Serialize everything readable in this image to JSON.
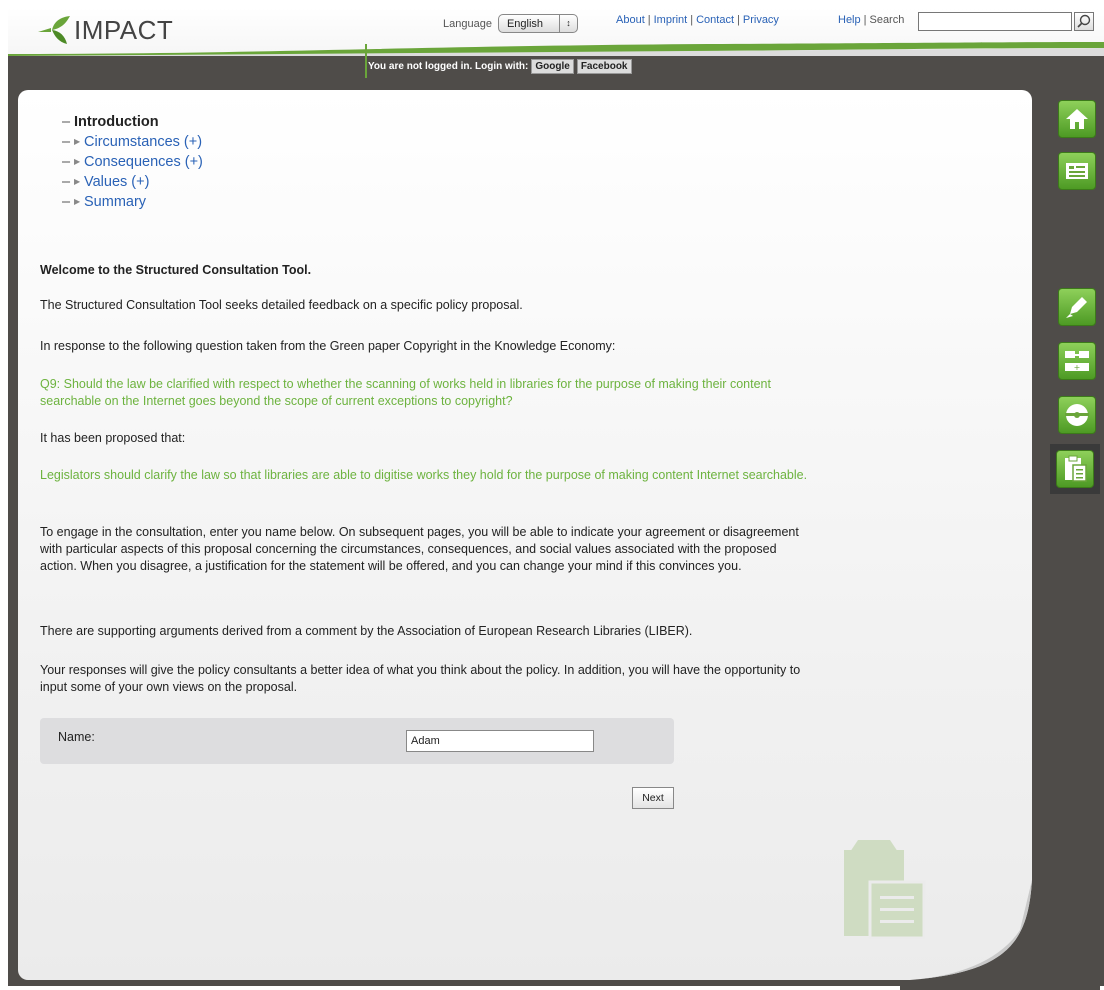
{
  "header": {
    "logo_text": "IMPACT",
    "language_label": "Language",
    "language_value": "English",
    "links": [
      "About",
      "Imprint",
      "Contact",
      "Privacy"
    ],
    "help": "Help",
    "search": "Search",
    "login_text": "You are not logged in. Login with:",
    "login_google": "Google",
    "login_facebook": "Facebook"
  },
  "toc": {
    "current": "Introduction",
    "items": [
      "Circumstances (+)",
      "Consequences (+)",
      "Values (+)",
      "Summary"
    ]
  },
  "content": {
    "welcome": "Welcome to the Structured Consultation Tool.",
    "p1": "The Structured Consultation Tool seeks detailed feedback on a specific policy proposal.",
    "p2": "In response to the following question taken from the Green paper Copyright in the Knowledge Economy:",
    "question": "Q9: Should the law be clarified with respect to whether the scanning of works held in libraries for the purpose of making their content searchable on the Internet goes beyond the scope of current exceptions to copyright?",
    "p3": "It has been proposed that:",
    "proposal": "Legislators should clarify the law so that libraries are able to digitise works they hold for the purpose of making content Internet searchable.",
    "p4": "To engage in the consultation, enter you name below. On subsequent pages, you will be able to indicate your agreement or disagreement with particular aspects of this proposal concerning the circumstances, consequences, and social values associated with the proposed action. When you disagree, a justification for the statement will be offered, and you can change your mind if this convinces you.",
    "p5": "There are supporting arguments derived from a comment by the Association of European Research Libraries (LIBER).",
    "p6": "Your responses will give the policy consultants a better idea of what you think about the policy. In addition, you will have the opportunity to input some of your own views on the proposal."
  },
  "form": {
    "name_label": "Name:",
    "name_value": "Adam",
    "next_label": "Next"
  },
  "sidenav": {
    "icons": [
      "home-icon",
      "document-icon",
      "pencil-icon",
      "diagram-icon",
      "disc-icon",
      "clipboard-icon"
    ],
    "active": "clipboard-icon"
  },
  "colors": {
    "accent_green": "#6db33f",
    "link_blue": "#2a62b6",
    "frame_dark": "#4f4c49"
  }
}
